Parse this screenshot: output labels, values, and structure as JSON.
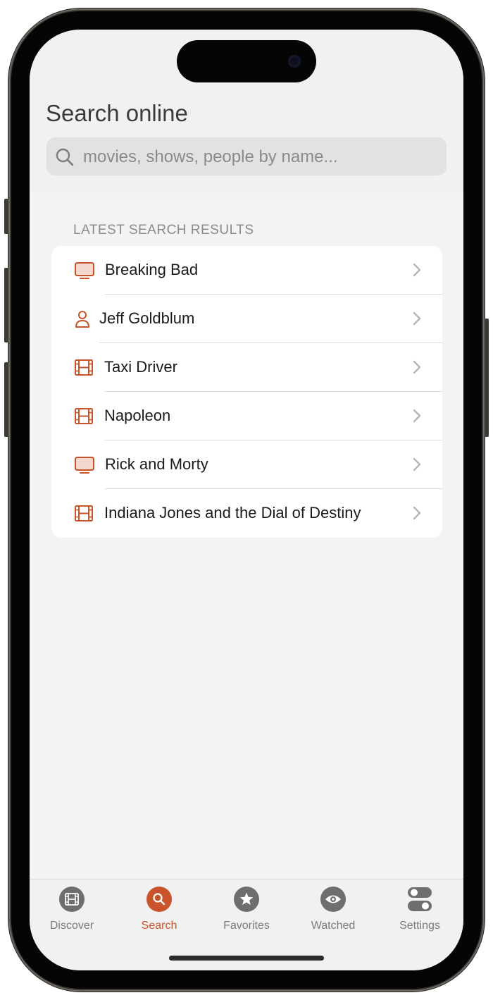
{
  "header": {
    "title": "Search online",
    "search_placeholder": "movies, shows, people by name..."
  },
  "results": {
    "section_label": "LATEST SEARCH RESULTS",
    "items": [
      {
        "label": "Breaking Bad",
        "kind": "tv-icon"
      },
      {
        "label": "Jeff Goldblum",
        "kind": "person-icon"
      },
      {
        "label": "Taxi Driver",
        "kind": "film-icon"
      },
      {
        "label": "Napoleon",
        "kind": "film-icon"
      },
      {
        "label": "Rick and Morty",
        "kind": "tv-icon"
      },
      {
        "label": "Indiana Jones and the Dial of Destiny",
        "kind": "film-icon"
      }
    ]
  },
  "tabbar": {
    "tabs": [
      {
        "label": "Discover",
        "icon": "film-icon",
        "active": false
      },
      {
        "label": "Search",
        "icon": "search-icon",
        "active": true
      },
      {
        "label": "Favorites",
        "icon": "star-icon",
        "active": false
      },
      {
        "label": "Watched",
        "icon": "eye-icon",
        "active": false
      },
      {
        "label": "Settings",
        "icon": "toggles-icon",
        "active": false
      }
    ]
  },
  "colors": {
    "accent": "#c9532a",
    "tab_inactive": "#6e6e6e",
    "background": "#f3f3f3"
  }
}
